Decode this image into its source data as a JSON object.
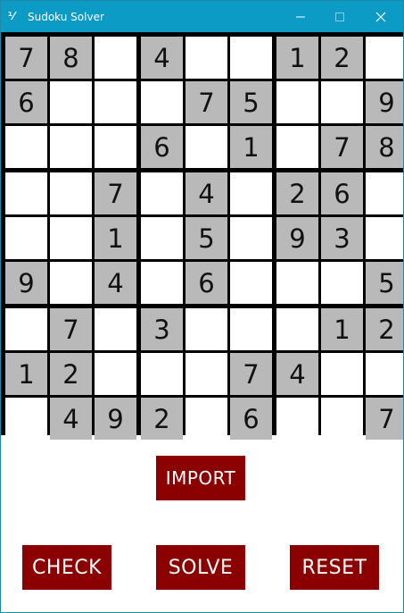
{
  "window": {
    "title": "Sudoku Solver",
    "icon_glyph": "⅟",
    "icon_name": "sudoku-app-icon",
    "titlebar_color": "#0b9bc4"
  },
  "board": {
    "given_color": "#b9b9b9",
    "empty_color": "#ffffff",
    "rows": [
      [
        "7",
        "8",
        "",
        "4",
        "",
        "",
        "1",
        "2",
        ""
      ],
      [
        "6",
        "",
        "",
        "",
        "7",
        "5",
        "",
        "",
        "9"
      ],
      [
        "",
        "",
        "",
        "6",
        "",
        "1",
        "",
        "7",
        "8"
      ],
      [
        "",
        "",
        "7",
        "",
        "4",
        "",
        "2",
        "6",
        ""
      ],
      [
        "",
        "",
        "1",
        "",
        "5",
        "",
        "9",
        "3",
        ""
      ],
      [
        "9",
        "",
        "4",
        "",
        "6",
        "",
        "",
        "",
        "5"
      ],
      [
        "",
        "7",
        "",
        "3",
        "",
        "",
        "",
        "1",
        "2"
      ],
      [
        "1",
        "2",
        "",
        "",
        "",
        "7",
        "4",
        "",
        ""
      ],
      [
        "",
        "4",
        "9",
        "2",
        "",
        "6",
        "",
        "",
        "7"
      ]
    ]
  },
  "buttons": {
    "import_label": "IMPORT",
    "check_label": "CHECK",
    "solve_label": "SOLVE",
    "reset_label": "RESET",
    "color": "#8b0000"
  }
}
